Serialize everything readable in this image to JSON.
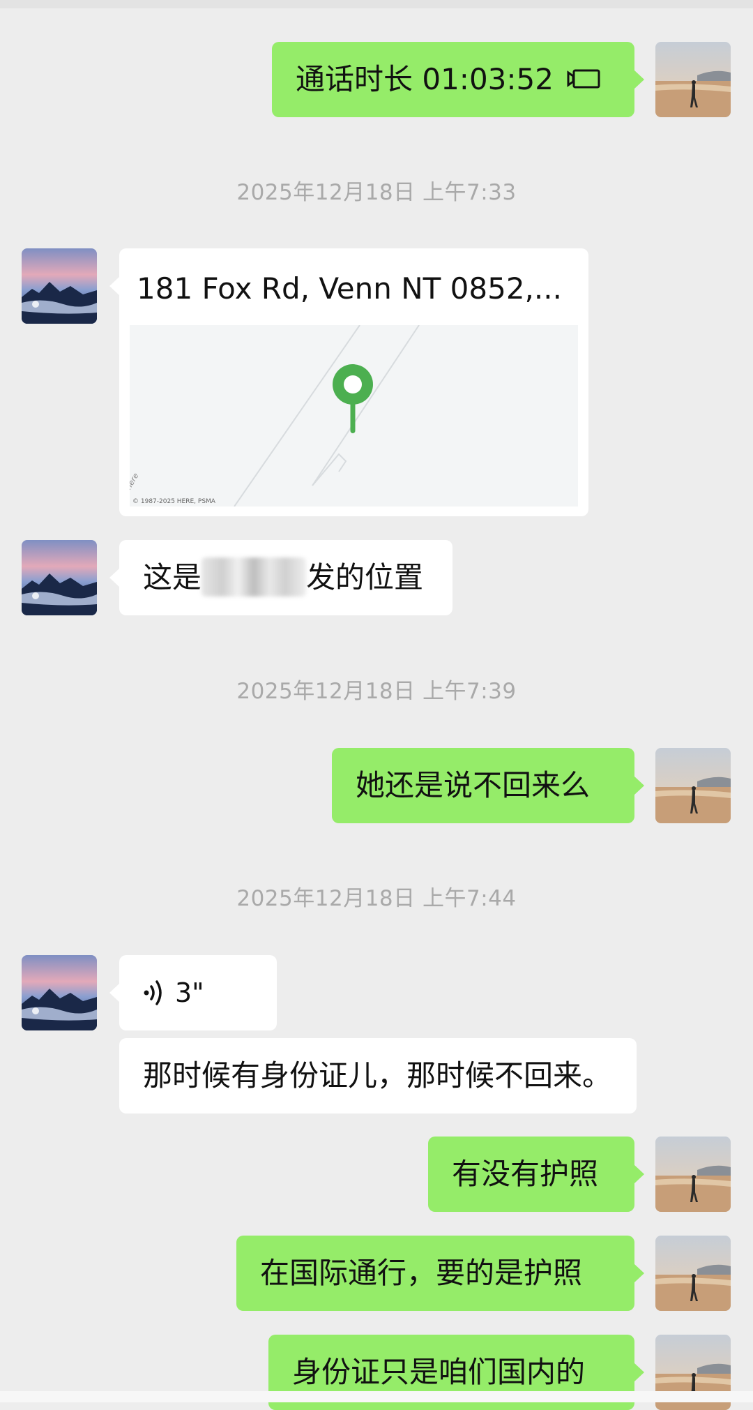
{
  "messages": {
    "call_duration": "通话时长 01:03:52",
    "timestamp_1": "2025年12月18日 上午7:33",
    "location_title": "181 Fox Rd, Venn NT 0852,...",
    "map_copyright": "© 1987-2025 HERE, PSMA",
    "map_logo": "here",
    "location_note_prefix": "这是",
    "location_note_suffix": "发的位置",
    "timestamp_2": "2025年12月18日 上午7:39",
    "msg_return": "她还是说不回来么",
    "timestamp_3": "2025年12月18日 上午7:44",
    "voice_duration": "3\"",
    "voice_transcript": "那时候有身份证儿，那时候不回来。",
    "msg_passport": "有没有护照",
    "msg_international": "在国际通行，要的是护照",
    "msg_domestic": "身份证只是咱们国内的"
  },
  "icons": {
    "call": "video-call-icon",
    "voice": "voice-wave-icon",
    "pin": "map-pin-icon"
  },
  "colors": {
    "background": "#ededed",
    "my_bubble": "#95ec69",
    "their_bubble": "#ffffff",
    "pin": "#4caf50",
    "timestamp": "#a9a9a9"
  }
}
